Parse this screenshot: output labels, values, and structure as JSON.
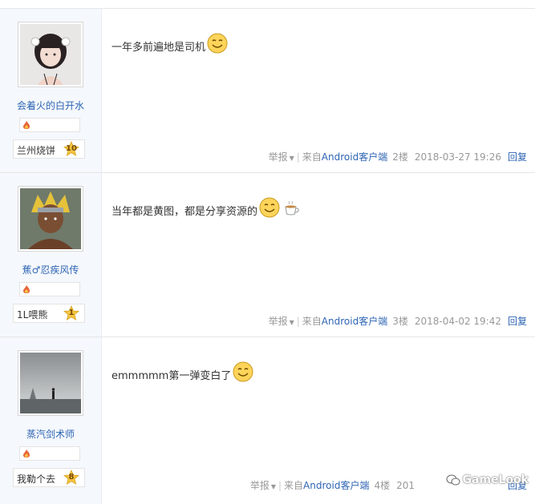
{
  "posts": [
    {
      "username": "会着火的白开水",
      "badge": "兰州烧饼",
      "badge_level": "10",
      "content": "一年多前遍地是司机",
      "report": "举报",
      "source_prefix": "来自",
      "source": "Android客户端",
      "floor": "2楼",
      "date": "2018-03-27 19:26",
      "reply": "回复"
    },
    {
      "username": "蕉♂忍疾风传",
      "badge": "1L喂熊",
      "badge_level": "1",
      "content": "当年都是黄图，都是分享资源的",
      "report": "举报",
      "source_prefix": "来自",
      "source": "Android客户端",
      "floor": "3楼",
      "date": "2018-04-02 19:42",
      "reply": "回复"
    },
    {
      "username": "蒸汽剑术师",
      "badge": "我勒个去",
      "badge_level": "8",
      "content": "emmmmm第一弹变白了",
      "report": "举报",
      "source_prefix": "来自",
      "source": "Android客户端",
      "floor": "4楼",
      "date": "201",
      "reply": "回复"
    }
  ],
  "watermark": "GameLook",
  "colors": {
    "link": "#2d64b3",
    "sidebar": "#f5f8fc",
    "meta": "#999999",
    "badge_star": "#f5c542"
  }
}
